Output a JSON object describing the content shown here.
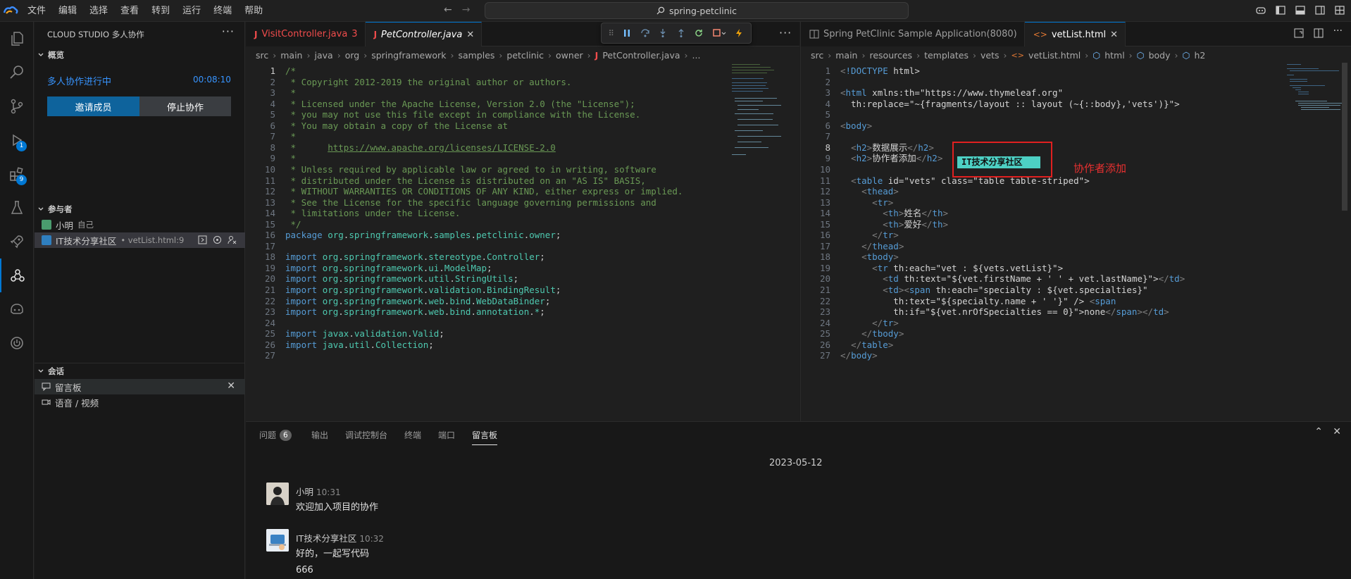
{
  "titlebar": {
    "menus": [
      "文件",
      "编辑",
      "选择",
      "查看",
      "转到",
      "运行",
      "终端",
      "帮助"
    ],
    "search": "spring-petclinic"
  },
  "activity": {
    "run_badge": "1",
    "ext_badge": "9"
  },
  "sidebar": {
    "title": "CLOUD STUDIO 多人协作",
    "overview_header": "概览",
    "collab_status": "多人协作进行中",
    "collab_time": "00:08:10",
    "invite_label": "邀请成员",
    "stop_label": "停止协作",
    "participants_header": "参与者",
    "participants": [
      {
        "name": "小明",
        "sub": "自己"
      },
      {
        "name": "IT技术分享社区",
        "sub": "• vetList.html:9"
      }
    ],
    "sessions_header": "会话",
    "sessions": [
      {
        "label": "留言板"
      },
      {
        "label": "语音 / 视频"
      }
    ]
  },
  "editor1": {
    "tabs": [
      {
        "label": "VisitController.java",
        "badge": "3"
      },
      {
        "label": "PetController.java"
      }
    ],
    "breadcrumb": [
      "src",
      "main",
      "java",
      "org",
      "springframework",
      "samples",
      "petclinic",
      "owner",
      "PetController.java",
      "..."
    ],
    "lines": [
      "/*",
      " * Copyright 2012-2019 the original author or authors.",
      " *",
      " * Licensed under the Apache License, Version 2.0 (the \"License\");",
      " * you may not use this file except in compliance with the License.",
      " * You may obtain a copy of the License at",
      " *",
      " *      https://www.apache.org/licenses/LICENSE-2.0",
      " *",
      " * Unless required by applicable law or agreed to in writing, software",
      " * distributed under the License is distributed on an \"AS IS\" BASIS,",
      " * WITHOUT WARRANTIES OR CONDITIONS OF ANY KIND, either express or implied.",
      " * See the License for the specific language governing permissions and",
      " * limitations under the License.",
      " */",
      "package org.springframework.samples.petclinic.owner;",
      "",
      "import org.springframework.stereotype.Controller;",
      "import org.springframework.ui.ModelMap;",
      "import org.springframework.util.StringUtils;",
      "import org.springframework.validation.BindingResult;",
      "import org.springframework.web.bind.WebDataBinder;",
      "import org.springframework.web.bind.annotation.*;",
      "",
      "import javax.validation.Valid;",
      "import java.util.Collection;",
      ""
    ]
  },
  "editor2": {
    "tabs": [
      {
        "label": "Spring PetClinic Sample Application(8080)"
      },
      {
        "label": "vetList.html"
      }
    ],
    "breadcrumb": [
      "src",
      "main",
      "resources",
      "templates",
      "vets",
      "vetList.html",
      "html",
      "body",
      "h2"
    ],
    "lines": [
      "<!DOCTYPE html>",
      "",
      "<html xmlns:th=\"https://www.thymeleaf.org\"",
      "  th:replace=\"~{fragments/layout :: layout (~{::body},'vets')}\">",
      "",
      "<body>",
      "",
      "  <h2>数据展示</h2>",
      "  <h2>协作者添加</h2>",
      "",
      "  <table id=\"vets\" class=\"table table-striped\">",
      "    <thead>",
      "      <tr>",
      "        <th>姓名</th>",
      "        <th>爱好</th>",
      "      </tr>",
      "    </thead>",
      "    <tbody>",
      "      <tr th:each=\"vet : ${vets.vetList}\">",
      "        <td th:text=\"${vet.firstName + ' ' + vet.lastName}\"></td>",
      "        <td><span th:each=\"specialty : ${vet.specialties}\"",
      "          th:text=\"${specialty.name + ' '}\" /> <span",
      "          th:if=\"${vet.nrOfSpecialties == 0}\">none</span></td>",
      "      </tr>",
      "    </tbody>",
      "  </table>",
      "</body>"
    ],
    "cursor_label": "IT技术分享社区",
    "annotation": "协作者添加"
  },
  "panel": {
    "tabs": [
      {
        "label": "问题",
        "badge": "6"
      },
      {
        "label": "输出"
      },
      {
        "label": "调试控制台"
      },
      {
        "label": "终端"
      },
      {
        "label": "端口"
      },
      {
        "label": "留言板"
      }
    ],
    "date": "2023-05-12",
    "messages": [
      {
        "user": "小明",
        "time": "10:31",
        "lines": [
          "欢迎加入项目的协作"
        ]
      },
      {
        "user": "IT技术分享社区",
        "time": "10:32",
        "lines": [
          "好的，一起写代码",
          "666"
        ]
      }
    ]
  }
}
